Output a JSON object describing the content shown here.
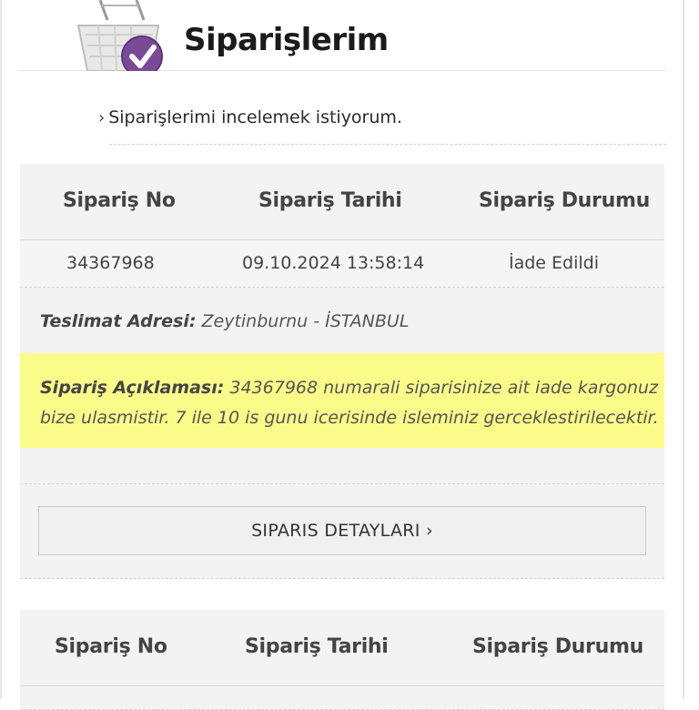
{
  "header": {
    "title": "Siparişlerim",
    "icon": "basket-check-icon"
  },
  "breadcrumb": {
    "text": "Siparişlerimi incelemek istiyorum."
  },
  "table_headers": {
    "order_no": "Sipariş No",
    "order_date": "Sipariş Tarihi",
    "order_status": "Sipariş Durumu"
  },
  "orders": [
    {
      "order_no": "34367968",
      "order_date": "09.10.2024 13:58:14",
      "status": "İade Edildi",
      "address_label": "Teslimat Adresi:",
      "address_value": " Zeytinburnu - İSTANBUL",
      "note_label": "Sipariş Açıklaması:",
      "note_value": " 34367968 numarali siparisinize ait iade kargonuz bize ulasmistir. 7 ile 10 is gunu icerisinde isleminiz gerceklestirilecektir.",
      "details_button": "SIPARIS DETAYLARI ›"
    }
  ],
  "colors": {
    "note_bg": "#fbfb8a",
    "card_bg": "#f3f3f3",
    "badge": "#7b4a97"
  }
}
